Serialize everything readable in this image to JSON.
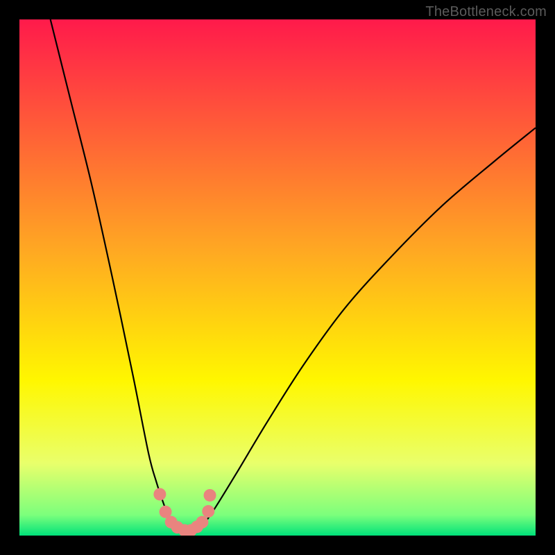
{
  "watermark": "TheBottleneck.com",
  "chart_data": {
    "type": "line",
    "title": "",
    "xlabel": "",
    "ylabel": "",
    "xlim": [
      0,
      100
    ],
    "ylim": [
      0,
      100
    ],
    "gradient_stops": [
      {
        "offset": 0,
        "color": "#ff1a4b"
      },
      {
        "offset": 45,
        "color": "#ffa922"
      },
      {
        "offset": 70,
        "color": "#fff700"
      },
      {
        "offset": 86,
        "color": "#e9ff6b"
      },
      {
        "offset": 96,
        "color": "#7cff7c"
      },
      {
        "offset": 100,
        "color": "#00e27a"
      }
    ],
    "series": [
      {
        "name": "bottleneck-curve",
        "x": [
          6,
          10,
          14,
          18,
          22,
          25,
          26.5,
          28,
          29,
          30,
          31,
          32,
          33,
          34,
          35,
          36,
          38,
          42,
          48,
          55,
          63,
          72,
          82,
          92,
          100
        ],
        "y": [
          100,
          84,
          68,
          50,
          31,
          16,
          10.5,
          6,
          3.5,
          2,
          1.2,
          1,
          1,
          1.1,
          1.6,
          2.6,
          5.5,
          12,
          22,
          33,
          44,
          54,
          64,
          72.5,
          79
        ]
      }
    ],
    "highlight_points": {
      "name": "markers",
      "color": "#e9847f",
      "x": [
        27.2,
        28.3,
        29.4,
        30.6,
        32.0,
        33.2,
        34.4,
        35.4,
        36.6,
        36.9
      ],
      "y": [
        8.0,
        4.6,
        2.6,
        1.6,
        1.0,
        1.0,
        1.7,
        2.6,
        4.7,
        7.8
      ]
    }
  }
}
